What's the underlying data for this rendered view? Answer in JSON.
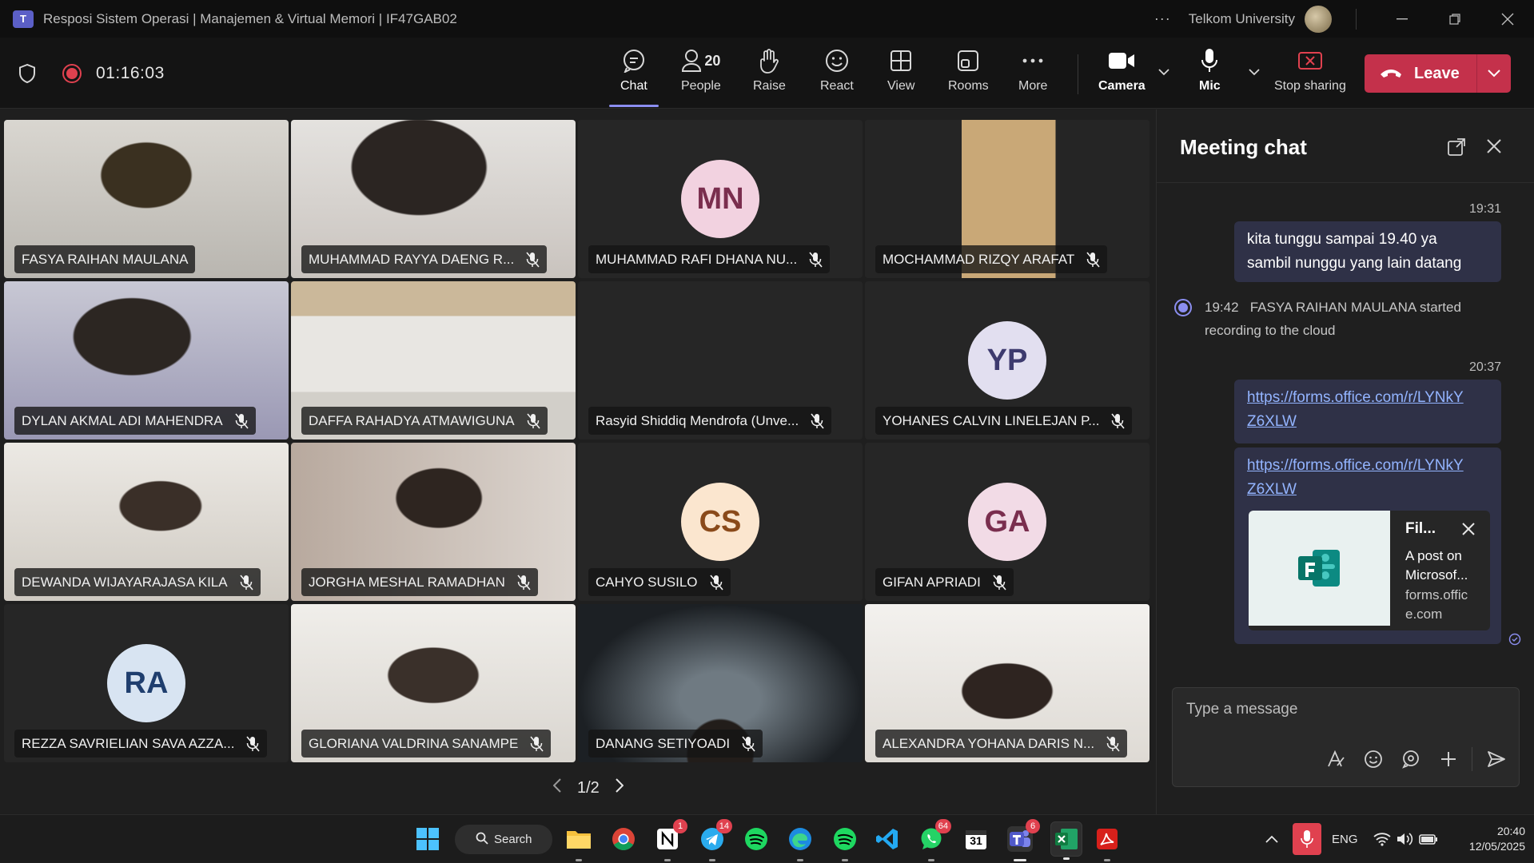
{
  "window": {
    "title": "Resposi Sistem Operasi | Manajemen & Virtual Memori | IF47GAB02",
    "org": "Telkom University",
    "more_dots": "···"
  },
  "toolbar": {
    "timer": "01:16:03",
    "buttons": {
      "chat": "Chat",
      "people": "People",
      "people_count": "20",
      "raise": "Raise",
      "react": "React",
      "view": "View",
      "rooms": "Rooms",
      "more": "More",
      "camera": "Camera",
      "mic": "Mic",
      "stop_sharing": "Stop sharing"
    },
    "leave": "Leave"
  },
  "participants": [
    {
      "name": "FASYA RAIHAN MAULANA",
      "type": "video",
      "muted": false
    },
    {
      "name": "MUHAMMAD RAYYA DAENG R...",
      "type": "video",
      "muted": true
    },
    {
      "name": "MUHAMMAD RAFI DHANA NU...",
      "type": "avatar",
      "initials": "MN",
      "avatar_bg": "#f2d2e0",
      "avatar_fg": "#7a2e4e",
      "muted": true
    },
    {
      "name": "MOCHAMMAD RIZQY ARAFAT",
      "type": "video",
      "muted": true
    },
    {
      "name": "DYLAN AKMAL ADI MAHENDRA",
      "type": "video",
      "muted": true
    },
    {
      "name": "DAFFA RAHADYA ATMAWIGUNA",
      "type": "video",
      "muted": true
    },
    {
      "name": "Rasyid Shiddiq Mendrofa (Unve...",
      "type": "blank",
      "muted": true
    },
    {
      "name": "YOHANES CALVIN LINELEJAN P...",
      "type": "avatar",
      "initials": "YP",
      "avatar_bg": "#e2dff0",
      "avatar_fg": "#3d3a6e",
      "muted": true
    },
    {
      "name": "DEWANDA WIJAYARAJASA KILA",
      "type": "video",
      "muted": true
    },
    {
      "name": "JORGHA MESHAL RAMADHAN",
      "type": "video",
      "muted": true
    },
    {
      "name": "CAHYO SUSILO",
      "type": "avatar",
      "initials": "CS",
      "avatar_bg": "#fbe6cf",
      "avatar_fg": "#8a4a1a",
      "muted": true
    },
    {
      "name": "GIFAN APRIADI",
      "type": "avatar",
      "initials": "GA",
      "avatar_bg": "#f2dbe6",
      "avatar_fg": "#7a2e4e",
      "muted": true
    },
    {
      "name": "REZZA SAVRIELIAN SAVA AZZA...",
      "type": "avatar",
      "initials": "RA",
      "avatar_bg": "#d8e4f2",
      "avatar_fg": "#1f3e6e",
      "muted": true
    },
    {
      "name": "GLORIANA VALDRINA SANAMPE",
      "type": "video",
      "muted": true
    },
    {
      "name": "DANANG SETIYOADI",
      "type": "video",
      "muted": true
    },
    {
      "name": "ALEXANDRA YOHANA DARIS N...",
      "type": "video",
      "muted": true
    }
  ],
  "pager": {
    "label": "1/2"
  },
  "chat": {
    "title": "Meeting chat",
    "messages": [
      {
        "time": "19:31",
        "text_line1": "kita tunggu sampai 19.40 ya",
        "text_line2": "sambil nunggu yang lain datang"
      },
      {
        "time": "19:42",
        "system": "FASYA RAIHAN MAULANA started recording to the cloud"
      },
      {
        "time": "20:37",
        "link1_line1": "https://forms.office.com/r/LYNkY",
        "link1_line2": "Z6XLW",
        "link2_line1": "https://forms.office.com/r/LYNkY",
        "link2_line2": "Z6XLW"
      }
    ],
    "preview": {
      "title": "Fil...",
      "desc": "A post on Microsof...",
      "source": "forms.office.com"
    },
    "composer_placeholder": "Type a message"
  },
  "taskbar": {
    "search": "Search",
    "badges": {
      "notion": "1",
      "telegram": "14",
      "whatsapp": "64",
      "teams": "6"
    },
    "calendar_day": "31",
    "lang": "ENG",
    "time": "20:40",
    "date": "12/05/2025"
  },
  "colors": {
    "accent": "#8b8ef0",
    "leave": "#c4314b",
    "recording": "#e0414f"
  }
}
